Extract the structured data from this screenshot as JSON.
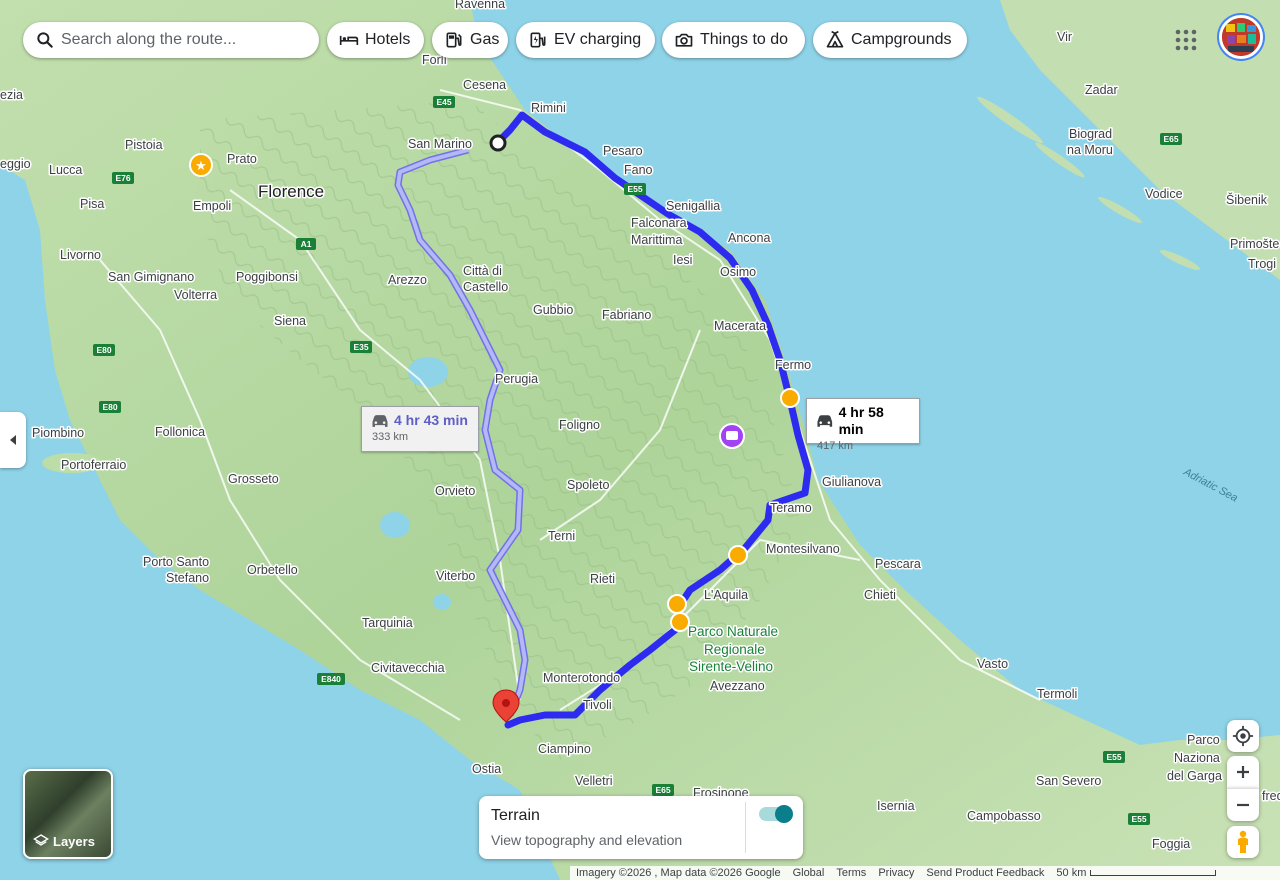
{
  "search": {
    "placeholder": "Search along the route..."
  },
  "chips": [
    {
      "label": "Hotels",
      "icon": "bed-icon"
    },
    {
      "label": "Gas",
      "icon": "gas-pump-icon"
    },
    {
      "label": "EV charging",
      "icon": "ev-charging-icon"
    },
    {
      "label": "Things to do",
      "icon": "camera-icon"
    },
    {
      "label": "Campgrounds",
      "icon": "tent-icon"
    }
  ],
  "routes": {
    "main": {
      "time": "4 hr 58 min",
      "distance": "417 km",
      "color": "#2e2bf0"
    },
    "alt": {
      "time": "4 hr 43 min",
      "distance": "333 km",
      "color": "#a4a7f2"
    }
  },
  "map_labels": {
    "cities_big": [
      "Florence"
    ],
    "cities": [
      "Ravenna",
      "Forlì",
      "Cesena",
      "Rimini",
      "San Marino",
      "Pesaro",
      "Fano",
      "Senigallia",
      "Falconara",
      "Marittima",
      "Ancona",
      "Iesi",
      "Osimo",
      "Macerata",
      "Fermo",
      "Giulianova",
      "Teramo",
      "Montesilvano",
      "Pescara",
      "Chieti",
      "L'Aquila",
      "Avezzano",
      "Vasto",
      "Termoli",
      "San Severo",
      "Campobasso",
      "Isernia",
      "Foggia",
      "Frosinone",
      "Velletri",
      "Ciampino",
      "Ostia",
      "Tivoli",
      "Monterotondo",
      "Rieti",
      "Terni",
      "Spoleto",
      "Foligno",
      "Perugia",
      "Orvieto",
      "Viterbo",
      "Orbetello",
      "Tarquinia",
      "Civitavecchia",
      "Porto Santo",
      "Stefano",
      "Grosseto",
      "Follonica",
      "Piombino",
      "Portoferraio",
      "Siena",
      "Volterra",
      "San Gimignano",
      "Poggibonsi",
      "Arezzo",
      "Città di",
      "Castello",
      "Gubbio",
      "Fabriano",
      "Livorno",
      "Pisa",
      "Lucca",
      "Pistoia",
      "Prato",
      "Empoli",
      "eggio",
      "ezia",
      "Vir",
      "Zadar",
      "Biograd",
      "na Moru",
      "Vodice",
      "Šibenik",
      "Primošte",
      "Trogi",
      "Parco",
      "Naziona",
      "del Garga",
      "fred"
    ],
    "parks": [
      "Parco Naturale",
      "Regionale",
      "Sirente-Velino"
    ],
    "sea": [
      "Adriatic Sea"
    ],
    "shields": [
      "E45",
      "E55",
      "E76",
      "A1",
      "E35",
      "E80",
      "E840",
      "E65"
    ]
  },
  "terrain": {
    "title": "Terrain",
    "subtitle": "View topography and elevation",
    "enabled": true
  },
  "layers": {
    "label": "Layers"
  },
  "footer": {
    "imagery": "Imagery ©2026 , Map data ©2026 Google",
    "links": [
      "Global",
      "Terms",
      "Privacy",
      "Send Product Feedback"
    ],
    "scale": "50 km"
  },
  "colors": {
    "sea": "#8fd3e8",
    "land": "#b9dba6",
    "route_main": "#2e2bf0",
    "route_alt": "#a4a7f2",
    "destination_pin": "#ea4335",
    "poi": "#f9ab00"
  }
}
